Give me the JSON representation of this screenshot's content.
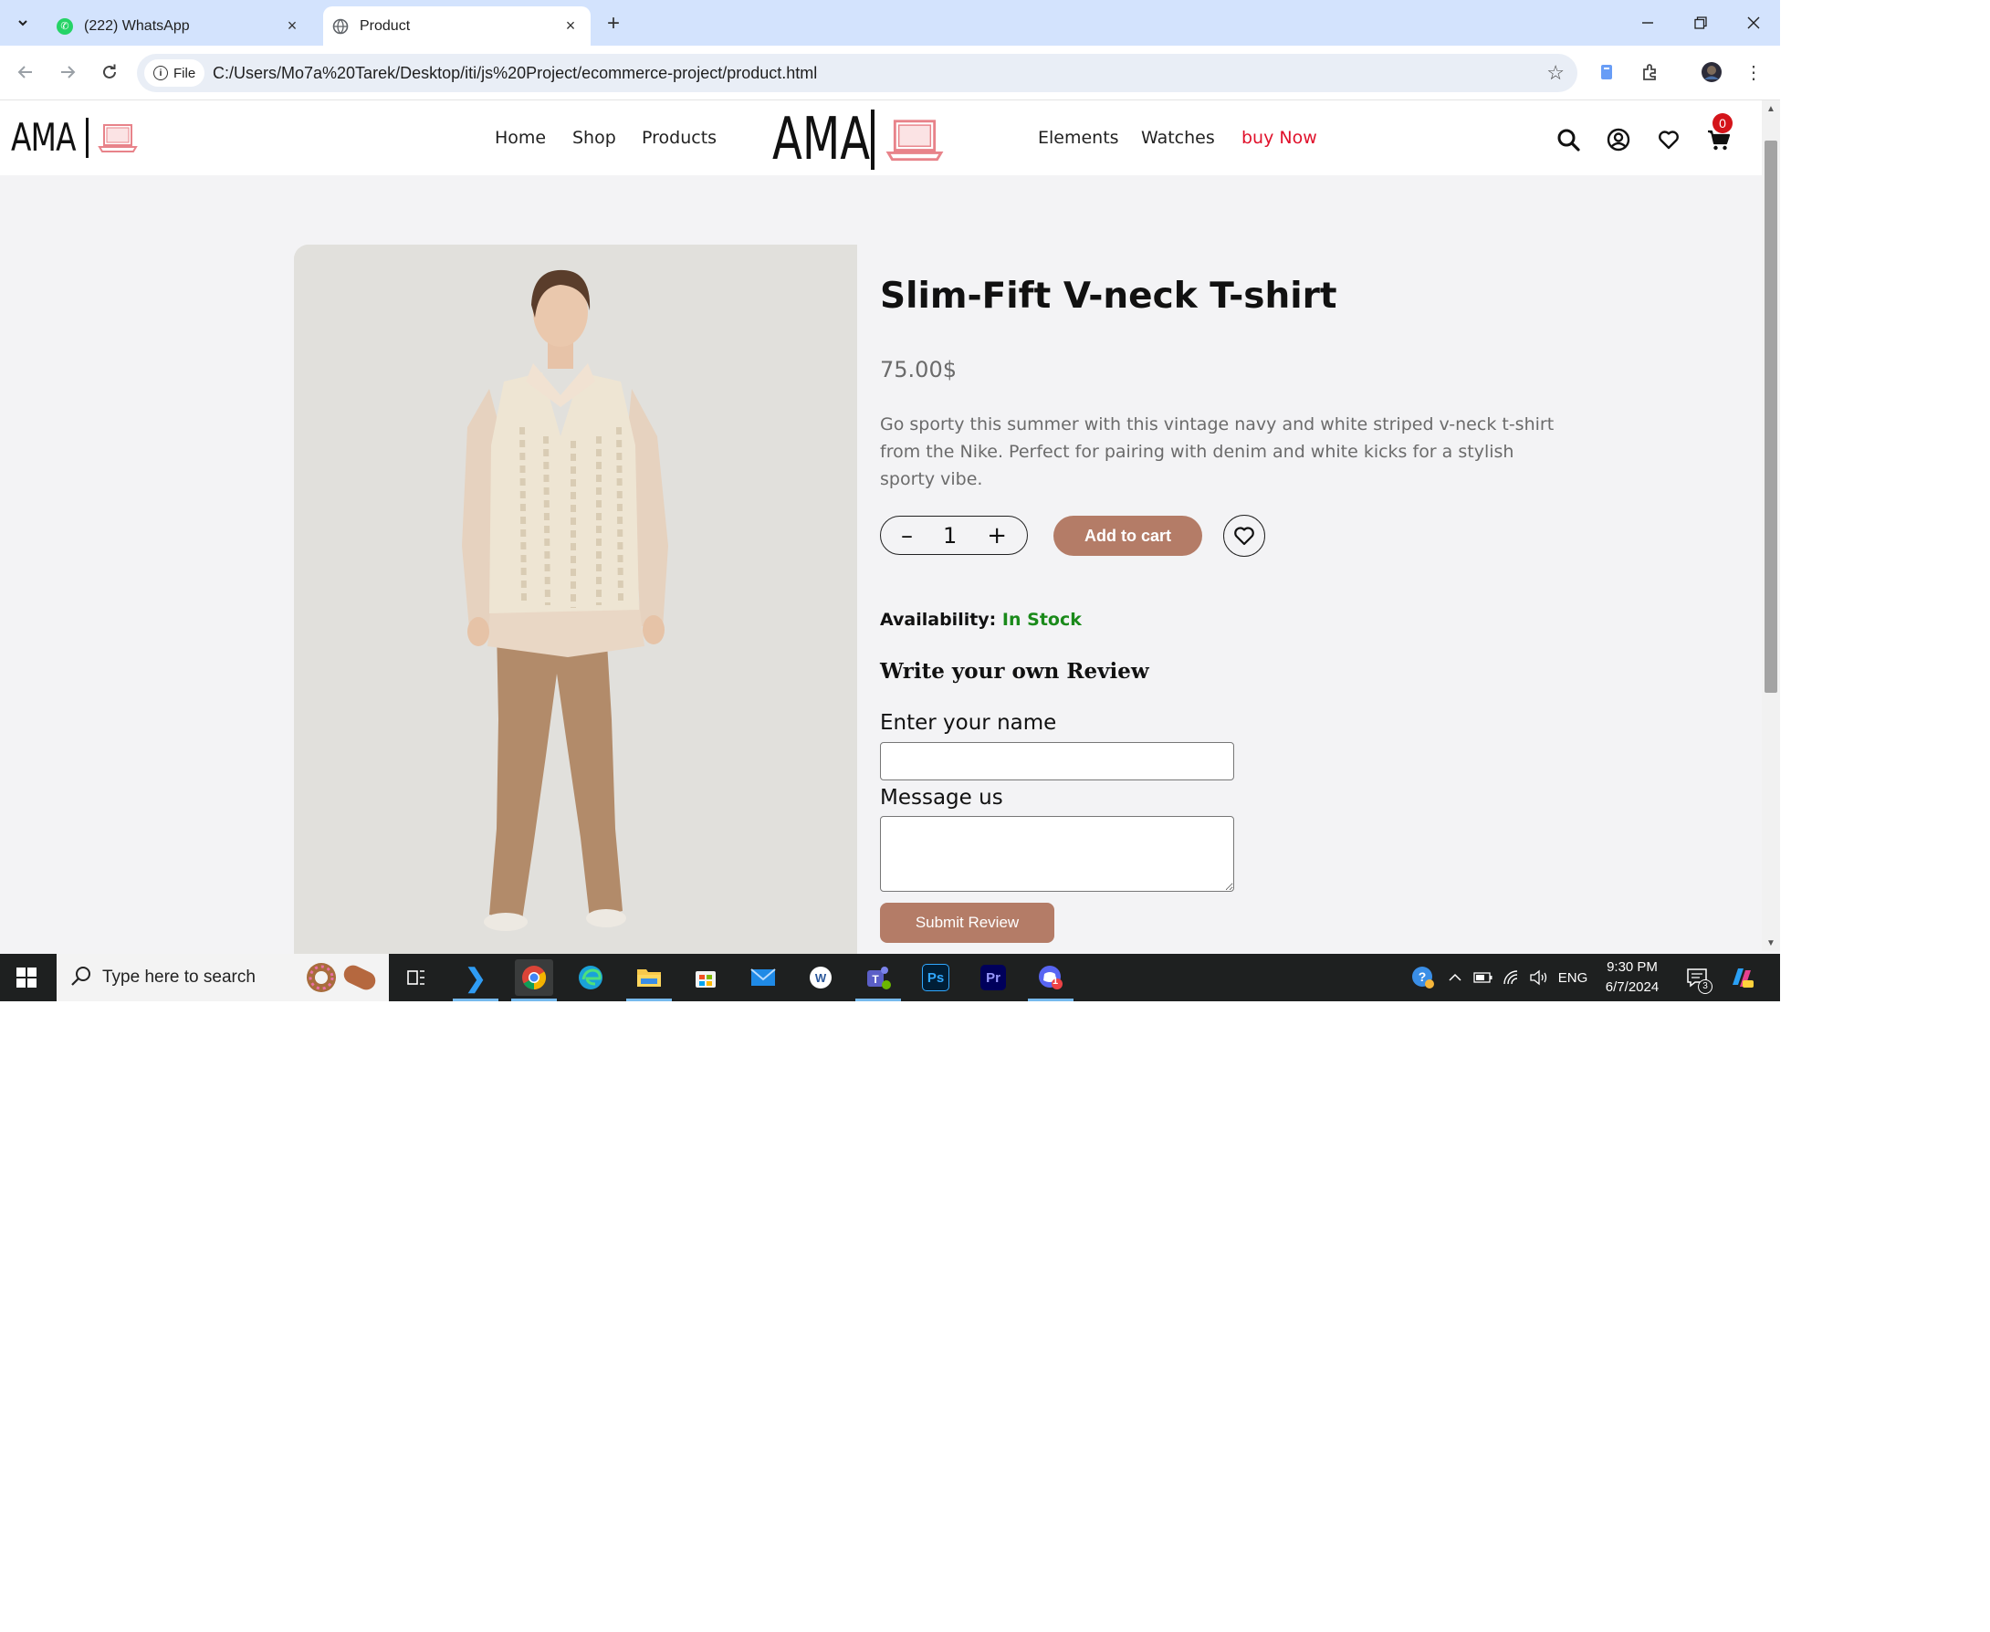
{
  "browser": {
    "tabs": [
      {
        "label": "(222) WhatsApp",
        "active": false,
        "icon": "whatsapp-icon"
      },
      {
        "label": "Product",
        "active": true,
        "icon": "globe-icon"
      }
    ],
    "address_chip": "File",
    "url": "C:/Users/Mo7a%20Tarek/Desktop/iti/js%20Project/ecommerce-project/product.html"
  },
  "site": {
    "logo_text": "AMA",
    "nav": [
      "Home",
      "Shop",
      "Products",
      "Elements",
      "Watches",
      "buy Now"
    ],
    "cart_count": "0"
  },
  "product": {
    "title": "Slim-Fift V-neck T-shirt",
    "price": "75.00$",
    "description": "Go sporty this summer with this vintage navy and white striped v-neck t-shirt from the Nike. Perfect for pairing with denim and white kicks for a stylish sporty vibe.",
    "qty_minus": "–",
    "quantity": "1",
    "qty_plus": "+",
    "add_to_cart": "Add to cart",
    "availability_label": "Availability:",
    "availability_value": "In Stock"
  },
  "review": {
    "title": "Write your own Review",
    "name_label": "Enter your name",
    "message_label": "Message us",
    "submit": "Submit Review"
  },
  "taskbar": {
    "search_placeholder": "Type here to search",
    "language": "ENG",
    "time": "9:30 PM",
    "date": "6/7/2024",
    "notification_count": "3",
    "discord_badge": "1"
  },
  "colors": {
    "accent": "#b47c67",
    "hot_nav": "#e0112b",
    "in_stock": "#1a8a1a",
    "tab_strip": "#d3e3fd"
  }
}
